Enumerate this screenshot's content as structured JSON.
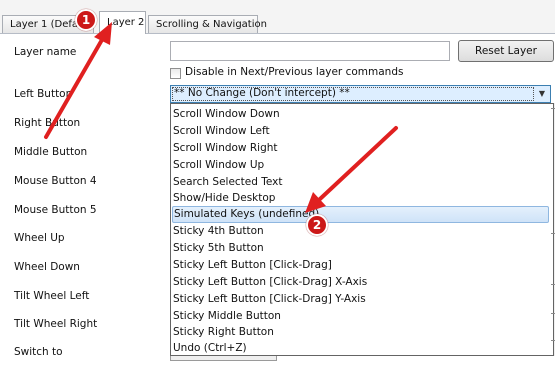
{
  "tabs": [
    {
      "label": "Layer 1 (Defa"
    },
    {
      "label": "Layer 2"
    },
    {
      "label": "Scrolling & Navigation"
    }
  ],
  "labels": {
    "layer_name": "Layer name",
    "left_button": "Left Button",
    "right_button": "Right Button",
    "middle_button": "Middle Button",
    "mouse_button_4": "Mouse Button 4",
    "mouse_button_5": "Mouse Button 5",
    "wheel_up": "Wheel Up",
    "wheel_down": "Wheel Down",
    "tilt_wheel_left": "Tilt Wheel Left",
    "tilt_wheel_right": "Tilt Wheel Right",
    "switch_to": "Switch to"
  },
  "layer_name_value": "",
  "reset_layer_label": "Reset Layer",
  "disable_checkbox": {
    "label": "Disable in Next/Previous layer commands",
    "checked": false
  },
  "left_button_select": {
    "value": "** No Change (Don't intercept) **"
  },
  "dropdown_items": [
    "Scroll Window Down",
    "Scroll Window Left",
    "Scroll Window Right",
    "Scroll Window Up",
    "Search Selected Text",
    "Show/Hide Desktop",
    "Simulated Keys (undefined)",
    "Sticky 4th Button",
    "Sticky 5th Button",
    "Sticky Left Button [Click-Drag]",
    "Sticky Left Button [Click-Drag] X-Axis",
    "Sticky Left Button [Click-Drag] Y-Axis",
    "Sticky Middle Button",
    "Sticky Right Button",
    "Undo (Ctrl+Z)"
  ],
  "highlighted_item": "Simulated Keys (undefined)",
  "annotations": [
    {
      "label": "1",
      "color": "#cc1818"
    },
    {
      "label": "2",
      "color": "#cc1818"
    }
  ],
  "colors": {
    "arrow": "#e02020",
    "highlight": "#cfe3f8",
    "combo_selected": "#ddeeff"
  }
}
